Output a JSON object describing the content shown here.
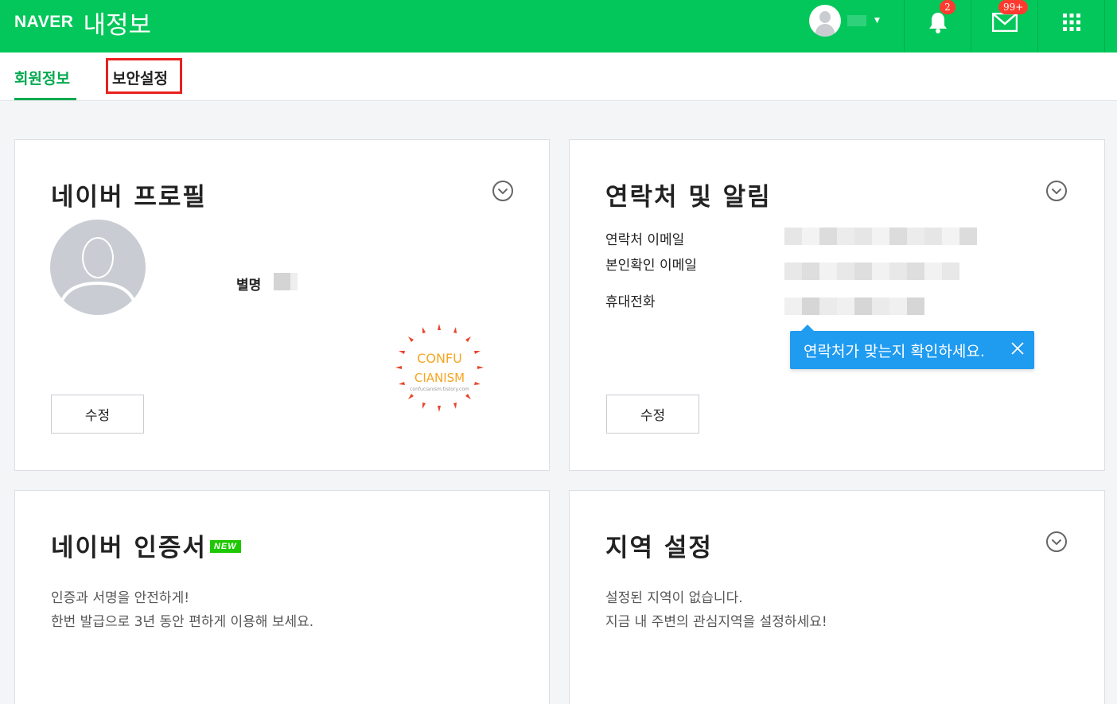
{
  "header": {
    "logo": "NAVER",
    "title": "내정보",
    "notification_count": "2",
    "mail_count": "99+"
  },
  "tabs": [
    {
      "label": "회원정보"
    },
    {
      "label": "보안설정"
    }
  ],
  "profile": {
    "title": "네이버 프로필",
    "nickname_label": "별명",
    "edit_label": "수정",
    "stamp_line1": "CONFU",
    "stamp_line2": "CIANISM",
    "stamp_url": "confucianism.tistory.com"
  },
  "contact": {
    "title": "연락처 및 알림",
    "email_label": "연락처 이메일",
    "verify_email_label": "본인확인 이메일",
    "phone_label": "휴대전화",
    "tooltip": "연락처가 맞는지 확인하세요.",
    "edit_label": "수정"
  },
  "certificate": {
    "title": "네이버 인증서",
    "badge": "NEW",
    "desc_line1": "인증과 서명을 안전하게!",
    "desc_line2": "한번 발급으로 3년 동안 편하게 이용해 보세요."
  },
  "region": {
    "title": "지역 설정",
    "desc_line1": "설정된 지역이 없습니다.",
    "desc_line2": "지금 내 주변의 관심지역을 설정하세요!"
  },
  "colors": {
    "brand_green": "#03c75a",
    "tab_active": "#03a94f",
    "tooltip_blue": "#1f9bf0",
    "badge_red": "#ff3b30",
    "highlight_red": "#e8201f"
  },
  "icons": [
    "naver-logo",
    "user-avatar-icon",
    "caret-down-icon",
    "bell-icon",
    "mail-icon",
    "apps-grid-icon",
    "chevron-down-circle-icon",
    "close-icon"
  ]
}
